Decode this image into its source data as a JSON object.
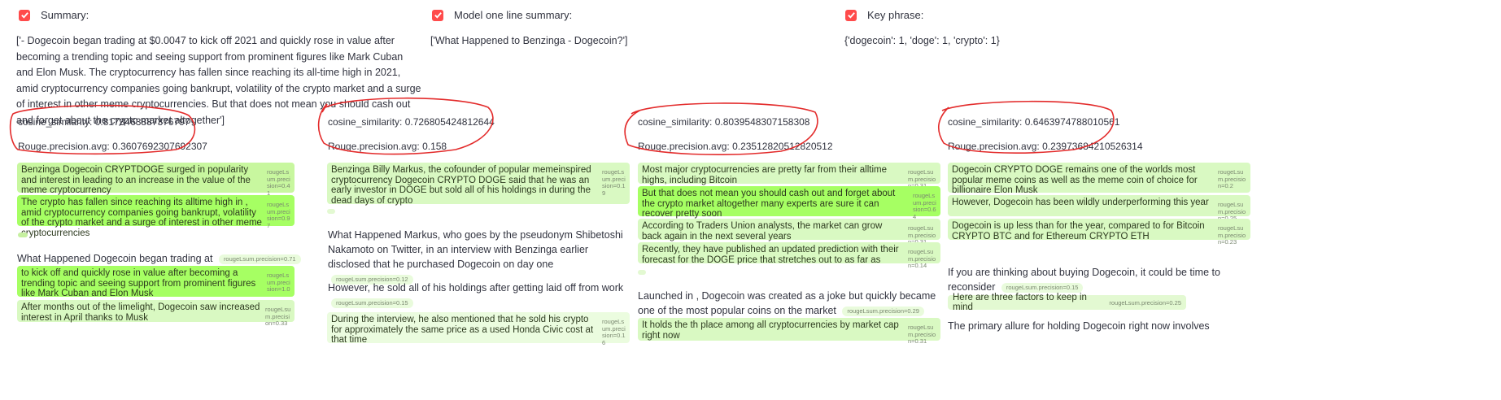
{
  "colors": {
    "checkbox": "#ff4b4b",
    "annotation": "#e32b2b",
    "highlight_strong": "#a6ff63",
    "highlight_light": "#d9f9c2"
  },
  "header": {
    "summary_label": "Summary:",
    "model_label": "Model one line summary:",
    "keyphrase_label": "Key phrase:"
  },
  "summary_text": "['- Dogecoin began trading at $0.0047 to kick off 2021 and quickly rose in value after becoming a trending topic and seeing support from prominent figures like Mark Cuban and Elon Musk. The cryptocurrency has fallen since reaching its all-time high in 2021, amid cryptocurrency companies going bankrupt, volatility of the crypto market and a surge of interest in other meme cryptocurrencies. But that does not mean you should cash out and forget about the crypto market altogether']",
  "model_summary_text": "['What Happened to Benzinga - Dogecoin?']",
  "keyphrase_text": "{'dogecoin': 1, 'doge': 1, 'crypto': 1}",
  "columns": [
    {
      "cosine": "cosine_similarity: 0.8173463887376797",
      "rouge": "Rouge.precision.avg: 0.3607692307692307",
      "blocks": [
        {
          "text": "Benzinga Dogecoin CRYPTDOGE surged in popularity and interest in leading to an increase in the value of the meme cryptocurrency",
          "score": "rougeLsum.precision=0.41"
        },
        {
          "text": "The crypto has fallen since reaching its alltime high in , amid cryptocurrency companies going bankrupt, volatility of the crypto market and a surge of interest in other meme cryptocurrencies",
          "score": "rougeLsum.precision=0.97"
        },
        {
          "text": "to kick off and quickly rose in value after becoming a trending topic and seeing support from prominent figures like Mark Cuban and Elon Musk",
          "score": "rougeLsum.precision=1.0"
        },
        {
          "text": "After months out of the limelight, Dogecoin saw increased interest in April thanks to Musk",
          "score": "rougeLsum.precision=0.33"
        }
      ],
      "inline": {
        "text": "What Happened Dogecoin began trading at",
        "score": "rougeLsum.precision=0.71"
      }
    },
    {
      "cosine": "cosine_similarity: 0.726805424812644",
      "rouge": "Rouge.precision.avg: 0.158",
      "blocks": [
        {
          "text": "Benzinga Billy Markus, the cofounder of popular memeinspired cryptocurrency Dogecoin CRYPTO DOGE said that he was an early investor in DOGE but sold all of his holdings in during the dead days of crypto",
          "score": "rougeLsum.precision=0.19"
        },
        {
          "text": "During the interview, he also mentioned that he sold his crypto for approximately the same price as a used Honda Civic cost at that time",
          "score": "rougeLsum.precision=0.16"
        }
      ],
      "para1": "What Happened Markus, who goes by the pseudonym Shibetoshi Nakamoto on Twitter, in an interview with Benzinga earlier disclosed that he purchased Dogecoin on day one",
      "para1_score": "rougeLsum.precision=0.12",
      "para2": "However, he sold all of his holdings after getting laid off from work",
      "para2_score": "rougeLsum.precision=0.15"
    },
    {
      "cosine": "cosine_similarity: 0.8039548307158308",
      "rouge": "Rouge.precision.avg: 0.23512820512820512",
      "blocks": [
        {
          "text": "Most major cryptocurrencies are pretty far from their alltime highs, including Bitcoin",
          "score": "rougeLsum.precision=0.31"
        },
        {
          "text": "But that does not mean you should cash out and forget about the crypto market altogether many experts are sure it can recover pretty soon",
          "score": "rougeLsum.precision=0.64"
        },
        {
          "text": "According to Traders Union analysts, the market can grow back again in the next several years",
          "score": "rougeLsum.precision=0.31"
        },
        {
          "text": "Recently, they have published an updated prediction with their forecast for the DOGE price that stretches out to as far as",
          "score": "rougeLsum.precision=0.14"
        },
        {
          "text": "It holds the th place among all cryptocurrencies by market cap right now",
          "score": "rougeLsum.precision=0.31"
        }
      ],
      "para1": "Launched in , Dogecoin was created as a joke but quickly became one of the most popular coins on the market",
      "para1_score": "rougeLsum.precision=0.29"
    },
    {
      "cosine": "cosine_similarity: 0.6463974788010561",
      "rouge": "Rouge.precision.avg: 0.23973684210526314",
      "blocks": [
        {
          "text": "Dogecoin CRYPTO DOGE remains one of the worlds most popular meme coins as well as the meme coin of choice for billionaire Elon Musk",
          "score": "rougeLsum.precision=0.2"
        },
        {
          "text": "However, Dogecoin has been wildly underperforming this year",
          "score": "rougeLsum.precision=0.25"
        },
        {
          "text": "Dogecoin is up less than for the year, compared to for Bitcoin CRYPTO BTC and for Ethereum CRYPTO ETH",
          "score": "rougeLsum.precision=0.23"
        },
        {
          "text": "Here are three factors to keep in mind",
          "score": "rougeLsum.precision=0.25"
        }
      ],
      "para1": "If you are thinking about buying Dogecoin, it could be time to reconsider",
      "para1_score": "rougeLsum.precision=0.15",
      "para2": "The primary allure for holding Dogecoin right now involves"
    }
  ]
}
